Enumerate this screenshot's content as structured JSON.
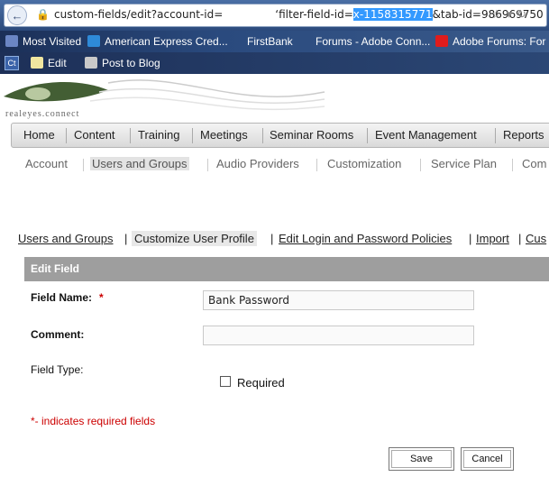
{
  "browser": {
    "url_before": "custom-fields/edit?account-id=",
    "url_mid": "‘filter-field-id=",
    "url_selected": "x-1158315771",
    "url_after": "&tab-id=986969750",
    "bookmarks": [
      "Most Visited",
      "American Express Cred...",
      "FirstBank",
      "Forums - Adobe Conn...",
      "Adobe Forums: For"
    ],
    "toolbar_items": [
      "Edit",
      "Post to Blog"
    ],
    "toolbar_badge": "Ct"
  },
  "header": {
    "logo_text": "realeyes.connect"
  },
  "mainnav": {
    "items": [
      "Home",
      "Content",
      "Training",
      "Meetings",
      "Seminar Rooms",
      "Event Management",
      "Reports"
    ]
  },
  "subnav": {
    "items": [
      "Account",
      "Users and Groups",
      "Audio Providers",
      "Customization",
      "Service Plan",
      "Com"
    ]
  },
  "crumbs": {
    "items": [
      "Users and Groups",
      "Customize User Profile",
      "Edit Login and Password Policies",
      "Import",
      "Cus"
    ]
  },
  "form": {
    "panel_title": "Edit Field",
    "field_name_label": "Field Name:",
    "required_star": "*",
    "field_name_value": "Bank Password",
    "comment_label": "Comment:",
    "comment_value": "",
    "field_type_label": "Field Type:",
    "required_checkbox_label": "Required",
    "required_note": "*- indicates required fields",
    "save_label": "Save",
    "cancel_label": "Cancel"
  },
  "colors": {
    "accent_selection": "#3399ff",
    "required_red": "#cc0000",
    "panel_gray": "#9e9e9e"
  }
}
